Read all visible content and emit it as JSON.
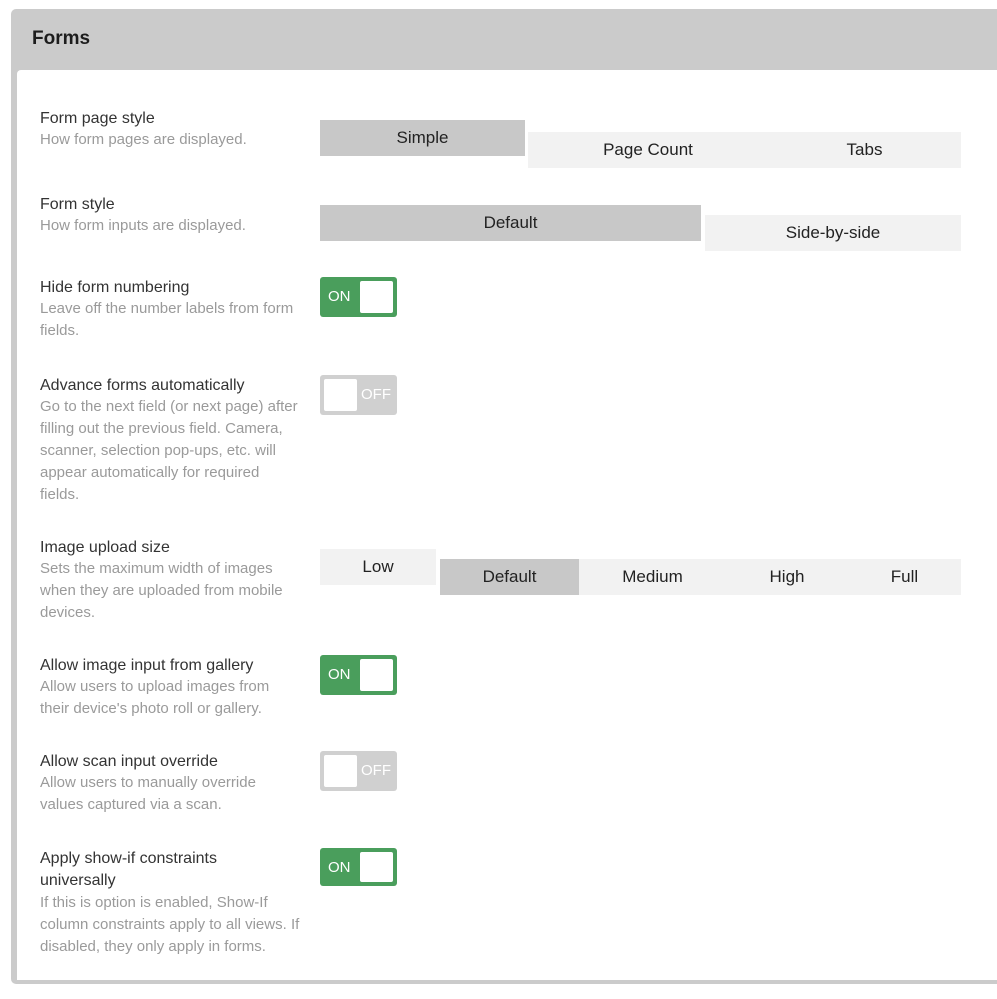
{
  "panel": {
    "title": "Forms"
  },
  "settings": {
    "form_page_style": {
      "label": "Form page style",
      "description": "How form pages are displayed.",
      "options": [
        "Simple",
        "Page Count",
        "Tabs"
      ],
      "selected": "Simple"
    },
    "form_style": {
      "label": "Form style",
      "description": "How form inputs are displayed.",
      "options": [
        "Default",
        "Side-by-side"
      ],
      "selected": "Default"
    },
    "hide_form_numbering": {
      "label": "Hide form numbering",
      "description": "Leave off the number labels from form fields.",
      "state": "ON"
    },
    "advance_forms": {
      "label": "Advance forms automatically",
      "description": "Go to the next field (or next page) after filling out the previous field. Camera, scanner, selection pop-ups, etc. will appear automatically for required fields.",
      "state": "OFF"
    },
    "image_upload_size": {
      "label": "Image upload size",
      "description": "Sets the maximum width of images when they are uploaded from mobile devices.",
      "options": [
        "Low",
        "Default",
        "Medium",
        "High",
        "Full"
      ],
      "selected": "Default"
    },
    "allow_image_gallery": {
      "label": "Allow image input from gallery",
      "description": "Allow users to upload images from their device's photo roll or gallery.",
      "state": "ON"
    },
    "allow_scan_override": {
      "label": "Allow scan input override",
      "description": "Allow users to manually override values captured via a scan.",
      "state": "OFF"
    },
    "apply_show_if": {
      "label": "Apply show-if constraints universally",
      "description": "If this is option is enabled, Show-If column constraints apply to all views. If disabled, they only apply in forms.",
      "state": "ON"
    }
  },
  "colors": {
    "toggle_on": "#4a9e5c",
    "toggle_off": "#d0d0d0",
    "segment_active": "#c8c8c8",
    "segment_inactive": "#f2f2f2"
  }
}
